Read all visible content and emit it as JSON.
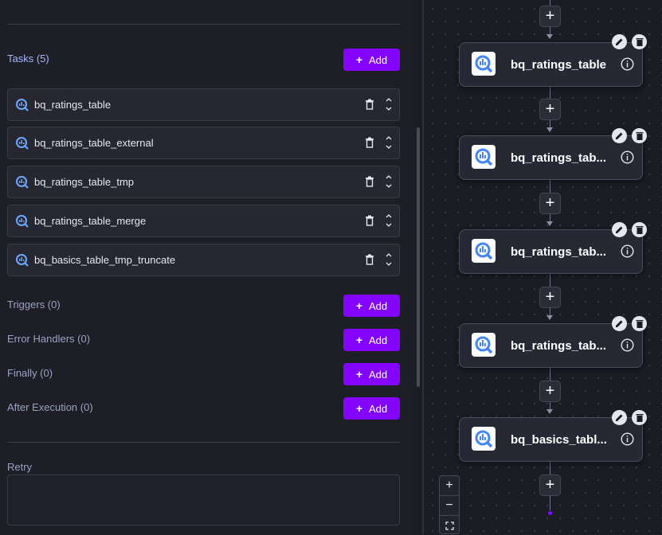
{
  "tasks": {
    "title": "Tasks (5)",
    "add_label": "Add",
    "items": [
      {
        "name": "bq_ratings_table"
      },
      {
        "name": "bq_ratings_table_external"
      },
      {
        "name": "bq_ratings_table_tmp"
      },
      {
        "name": "bq_ratings_table_merge"
      },
      {
        "name": "bq_basics_table_tmp_truncate"
      }
    ]
  },
  "sections": {
    "triggers": {
      "title": "Triggers (0)",
      "add_label": "Add"
    },
    "error_handlers": {
      "title": "Error Handlers (0)",
      "add_label": "Add"
    },
    "finally": {
      "title": "Finally (0)",
      "add_label": "Add"
    },
    "after_execution": {
      "title": "After Execution (0)",
      "add_label": "Add"
    }
  },
  "retry": {
    "label": "Retry",
    "value": ""
  },
  "canvas": {
    "nodes": [
      {
        "label": "bq_ratings_table"
      },
      {
        "label": "bq_ratings_tab..."
      },
      {
        "label": "bq_ratings_tab..."
      },
      {
        "label": "bq_ratings_tab..."
      },
      {
        "label": "bq_basics_tabl..."
      }
    ],
    "plus_symbol": "+",
    "zoom": {
      "in": "+",
      "out": "−"
    }
  },
  "colors": {
    "accent": "#8405ff",
    "background": "#1b1c24",
    "panel": "#262731"
  },
  "icons": [
    "bigquery-icon",
    "trash-icon",
    "chevron-up-down-icon",
    "plus-icon",
    "pencil-icon",
    "info-icon",
    "fit-view-icon"
  ]
}
